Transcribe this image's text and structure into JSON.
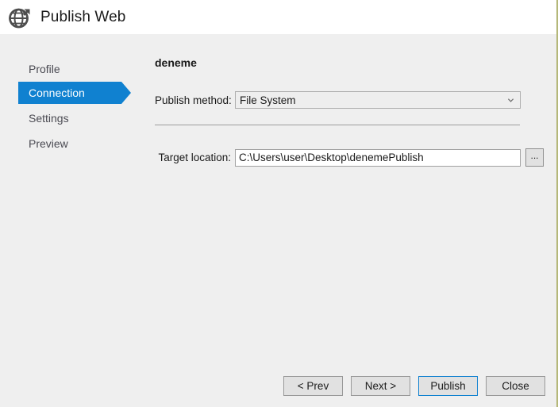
{
  "window": {
    "title": "Publish Web",
    "title_icon": "globe-publish-icon",
    "border_color": "#b5b87a",
    "header_background": "#ffffff",
    "body_background": "#efefef"
  },
  "sidebar": {
    "selected_color": "#1081d0",
    "items": [
      {
        "label": "Profile",
        "selected": false
      },
      {
        "label": "Connection",
        "selected": true
      },
      {
        "label": "Settings",
        "selected": false
      },
      {
        "label": "Preview",
        "selected": false
      }
    ]
  },
  "content": {
    "heading": "deneme",
    "publish_method": {
      "label": "Publish method:",
      "value": "File System",
      "chevron_icon": "chevron-down-icon",
      "options": [
        "File System"
      ]
    },
    "target_location": {
      "label": "Target location:",
      "value": "C:\\Users\\user\\Desktop\\denemePublish",
      "placeholder": "",
      "browse_label": "..."
    }
  },
  "footer": {
    "buttons": [
      {
        "label": "< Prev",
        "default": false
      },
      {
        "label": "Next >",
        "default": false
      },
      {
        "label": "Publish",
        "default": true
      },
      {
        "label": "Close",
        "default": false
      }
    ]
  }
}
